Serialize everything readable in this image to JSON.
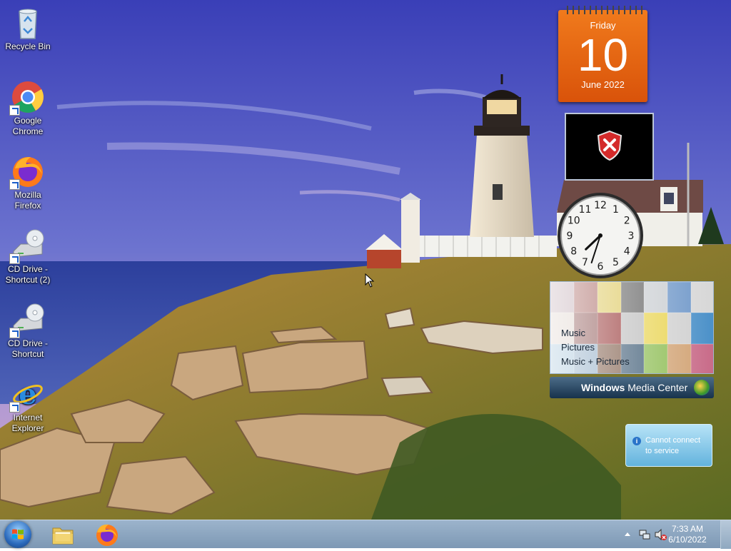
{
  "desktop": {
    "icons": [
      {
        "label": "Recycle Bin",
        "icon": "recycle-bin-icon"
      },
      {
        "label": "Google Chrome",
        "icon": "chrome-icon"
      },
      {
        "label": "Mozilla Firefox",
        "icon": "firefox-icon"
      },
      {
        "label": "CD Drive - Shortcut (2)",
        "icon": "cd-drive-icon"
      },
      {
        "label": "CD Drive - Shortcut",
        "icon": "cd-drive-icon"
      },
      {
        "label": "Internet Explorer",
        "icon": "internet-explorer-icon"
      }
    ]
  },
  "gadgets": {
    "calendar": {
      "weekday": "Friday",
      "day": "10",
      "month_year": "June 2022"
    },
    "clock": {
      "numbers": [
        "12",
        "1",
        "2",
        "3",
        "4",
        "5",
        "6",
        "7",
        "8",
        "9",
        "10",
        "11"
      ],
      "hour": 7,
      "minute": 33
    },
    "media_center": {
      "items": [
        "Music",
        "Pictures",
        "Music + Pictures"
      ],
      "bar_label_bold": "Windows",
      "bar_label": "Media Center"
    },
    "weather_notice": {
      "text": "Cannot connect to service"
    }
  },
  "taskbar": {
    "pinned": [
      "windows-explorer-icon",
      "firefox-icon"
    ],
    "clock": {
      "time": "7:33 AM",
      "date": "6/10/2022"
    }
  },
  "colors": {
    "calendar": "#e0600e",
    "taskbar": "#8aa4be",
    "accent": "#2c6bbd"
  }
}
